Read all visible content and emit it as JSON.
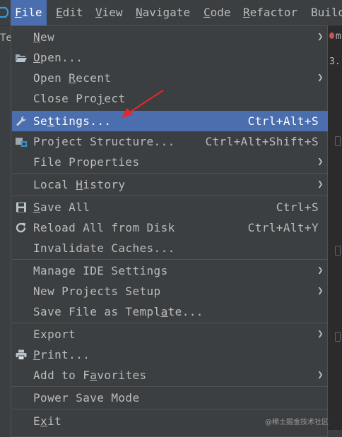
{
  "menubar": {
    "items": [
      {
        "pre": "",
        "mn": "F",
        "post": "ile"
      },
      {
        "pre": "",
        "mn": "E",
        "post": "dit"
      },
      {
        "pre": "",
        "mn": "V",
        "post": "iew"
      },
      {
        "pre": "",
        "mn": "N",
        "post": "avigate"
      },
      {
        "pre": "",
        "mn": "C",
        "post": "ode"
      },
      {
        "pre": "",
        "mn": "R",
        "post": "efactor"
      },
      {
        "pre": "Buil",
        "mn": "",
        "post": "d"
      }
    ]
  },
  "background": {
    "left_tab": "Te",
    "right_tab_1": "m",
    "right_tab_2": "3."
  },
  "file_menu": {
    "items": [
      {
        "pre": "",
        "mn": "N",
        "post": "ew",
        "shortcut": "",
        "submenu": true,
        "icon": ""
      },
      {
        "pre": "",
        "mn": "O",
        "post": "pen...",
        "shortcut": "",
        "submenu": false,
        "icon": "folder-open-icon"
      },
      {
        "pre": "Open ",
        "mn": "R",
        "post": "ecent",
        "shortcut": "",
        "submenu": true,
        "icon": ""
      },
      {
        "pre": "Close Pro",
        "mn": "j",
        "post": "ect",
        "shortcut": "",
        "submenu": false,
        "icon": ""
      },
      {
        "pre": "Se",
        "mn": "t",
        "post": "tings...",
        "shortcut": "Ctrl+Alt+S",
        "submenu": false,
        "icon": "wrench-icon"
      },
      {
        "pre": "Project Structure...",
        "mn": "",
        "post": "",
        "shortcut": "Ctrl+Alt+Shift+S",
        "submenu": false,
        "icon": "project-structure-icon"
      },
      {
        "pre": "File Properties",
        "mn": "",
        "post": "",
        "shortcut": "",
        "submenu": true,
        "icon": ""
      },
      {
        "pre": "Local ",
        "mn": "H",
        "post": "istory",
        "shortcut": "",
        "submenu": true,
        "icon": ""
      },
      {
        "pre": "",
        "mn": "S",
        "post": "ave All",
        "shortcut": "Ctrl+S",
        "submenu": false,
        "icon": "save-icon"
      },
      {
        "pre": "Reload All from Disk",
        "mn": "",
        "post": "",
        "shortcut": "Ctrl+Alt+Y",
        "submenu": false,
        "icon": "reload-icon"
      },
      {
        "pre": "Invalidate Caches...",
        "mn": "",
        "post": "",
        "shortcut": "",
        "submenu": false,
        "icon": ""
      },
      {
        "pre": "Manage IDE Settings",
        "mn": "",
        "post": "",
        "shortcut": "",
        "submenu": true,
        "icon": ""
      },
      {
        "pre": "New Projects Setup",
        "mn": "",
        "post": "",
        "shortcut": "",
        "submenu": true,
        "icon": ""
      },
      {
        "pre": "Save File as Templ",
        "mn": "a",
        "post": "te...",
        "shortcut": "",
        "submenu": false,
        "icon": ""
      },
      {
        "pre": "Export",
        "mn": "",
        "post": "",
        "shortcut": "",
        "submenu": true,
        "icon": ""
      },
      {
        "pre": "",
        "mn": "P",
        "post": "rint...",
        "shortcut": "",
        "submenu": false,
        "icon": "print-icon"
      },
      {
        "pre": "Add to F",
        "mn": "a",
        "post": "vorites",
        "shortcut": "",
        "submenu": true,
        "icon": ""
      },
      {
        "pre": "Power Save Mode",
        "mn": "",
        "post": "",
        "shortcut": "",
        "submenu": false,
        "icon": ""
      },
      {
        "pre": "E",
        "mn": "x",
        "post": "it",
        "shortcut": "",
        "submenu": false,
        "icon": ""
      }
    ],
    "selected_label": "Settings...",
    "submenu_arrow": "❯"
  },
  "watermark": "@稀土掘金技术社区",
  "colors": {
    "menu_bg": "#3c3f41",
    "selection": "#4b6eaf",
    "annotation_arrow": "#e8262c",
    "text": "#bbbbbb"
  }
}
